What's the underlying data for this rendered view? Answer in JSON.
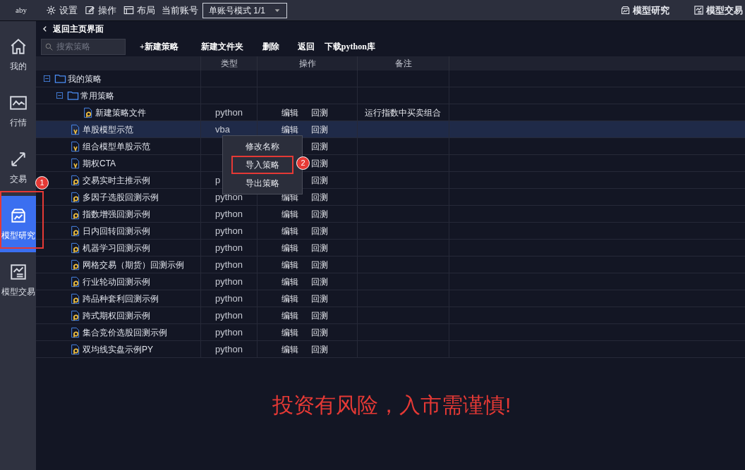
{
  "top_bar": {
    "app_name": "aby",
    "menus": [
      {
        "kind": "settings",
        "label": "设置"
      },
      {
        "kind": "edit",
        "label": "操作"
      },
      {
        "kind": "layout",
        "label": "布局"
      }
    ],
    "account_label": "当前账号",
    "account_select": "单账号模式 1/1",
    "right_tabs": [
      {
        "kind": "research",
        "label": "模型研究"
      },
      {
        "kind": "trade",
        "label": "模型交易"
      }
    ]
  },
  "sidebar": {
    "items": [
      {
        "kind": "home",
        "label": "我的",
        "selected": false
      },
      {
        "kind": "market",
        "label": "行情",
        "selected": false
      },
      {
        "kind": "trade",
        "label": "交易",
        "selected": false
      },
      {
        "kind": "research",
        "label": "模型研究",
        "selected": true
      },
      {
        "kind": "model_trade",
        "label": "模型交易",
        "selected": false
      }
    ]
  },
  "back_link": "返回主页界面",
  "search": {
    "placeholder": "搜索策略"
  },
  "toolbar": [
    "+新建策略",
    "新建文件夹",
    "删除",
    "返回",
    "下载python库"
  ],
  "table": {
    "columns": [
      "",
      "类型",
      "操作",
      "备注"
    ],
    "rows": [
      {
        "kind": "folder",
        "name": "我的策略",
        "expanded": true,
        "selected": false,
        "children": [
          {
            "kind": "folder",
            "name": "常用策略",
            "expanded": true,
            "selected": false,
            "children": [
              {
                "kind": "python",
                "name": "新建策略文件",
                "type": "python",
                "edit": "编辑",
                "backtest": "回测",
                "note": "运行指数中买卖组合",
                "selected": false
              }
            ]
          },
          {
            "kind": "vba",
            "name": "单股模型示范",
            "type": "vba",
            "edit": "编辑",
            "backtest": "回测",
            "selected": true
          },
          {
            "kind": "vba",
            "name": "组合模型单股示范",
            "backtest": "回测",
            "selected": false
          },
          {
            "kind": "vba",
            "name": "期权CTA",
            "backtest": "回测",
            "selected": false
          },
          {
            "kind": "python",
            "name": "交易实时主推示例",
            "type": "p",
            "backtest": "回测",
            "selected": false
          },
          {
            "kind": "python",
            "name": "多因子选股回测示例",
            "type": "python",
            "edit": "编辑",
            "backtest": "回测",
            "selected": false
          },
          {
            "kind": "python",
            "name": "指数增强回测示例",
            "type": "python",
            "edit": "编辑",
            "backtest": "回测",
            "selected": false
          },
          {
            "kind": "python",
            "name": "日内回转回测示例",
            "type": "python",
            "edit": "编辑",
            "backtest": "回测",
            "selected": false
          },
          {
            "kind": "python",
            "name": "机器学习回测示例",
            "type": "python",
            "edit": "编辑",
            "backtest": "回测",
            "selected": false
          },
          {
            "kind": "python",
            "name": "网格交易（期货）回测示例",
            "type": "python",
            "edit": "编辑",
            "backtest": "回测",
            "selected": false
          },
          {
            "kind": "python",
            "name": "行业轮动回测示例",
            "type": "python",
            "edit": "编辑",
            "backtest": "回测",
            "selected": false
          },
          {
            "kind": "python",
            "name": "跨品种套利回测示例",
            "type": "python",
            "edit": "编辑",
            "backtest": "回测",
            "selected": false
          },
          {
            "kind": "python",
            "name": "跨式期权回测示例",
            "type": "python",
            "edit": "编辑",
            "backtest": "回测",
            "selected": false
          },
          {
            "kind": "python",
            "name": "集合竞价选股回测示例",
            "type": "python",
            "edit": "编辑",
            "backtest": "回测",
            "selected": false
          },
          {
            "kind": "python",
            "name": "双均线实盘示例PY",
            "type": "python",
            "edit": "编辑",
            "backtest": "回测",
            "selected": false
          }
        ]
      }
    ]
  },
  "context_menu": {
    "items": [
      {
        "label": "修改名称",
        "selected": false
      },
      {
        "label": "导入策略",
        "selected": true
      },
      {
        "label": "导出策略",
        "selected": false
      }
    ]
  },
  "annotations": [
    {
      "kind": "sidebar",
      "label": "1"
    },
    {
      "kind": "menu",
      "label": "2"
    }
  ],
  "warning": "投资有风险，入市需谨慎!"
}
